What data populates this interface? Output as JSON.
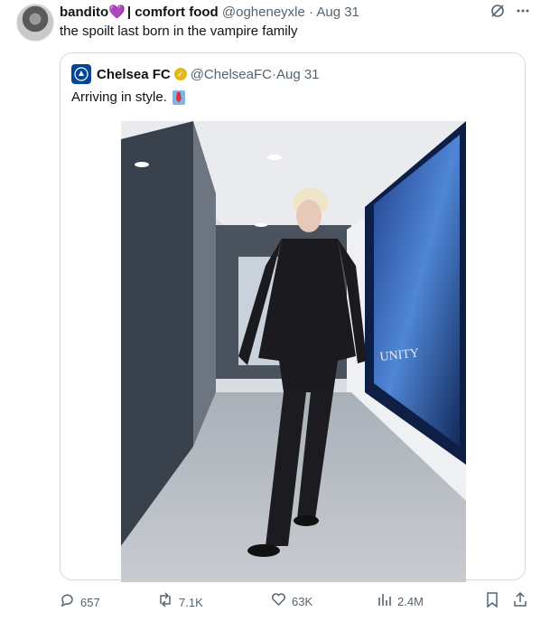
{
  "tweet": {
    "author_name": "bandito",
    "author_emoji": "💜",
    "author_suffix": "| comfort food",
    "handle": "@ogheneyxle",
    "separator": "·",
    "date": "Aug 31",
    "text": "the spoilt last born in the vampire family",
    "top_icons": [
      "grok-icon",
      "more-icon"
    ]
  },
  "quote": {
    "author_name": "Chelsea FC",
    "handle": "@ChelseaFC",
    "separator": "·",
    "date": "Aug 31",
    "text": "Arriving in style.",
    "photo_sign": "UNITY"
  },
  "actions": {
    "replies": "657",
    "retweets": "7.1K",
    "likes": "63K",
    "views": "2.4M"
  },
  "colors": {
    "muted": "#536471",
    "border": "#cfd9de",
    "chelsea_blue": "#034694",
    "verified_gold": "#e2b719"
  }
}
